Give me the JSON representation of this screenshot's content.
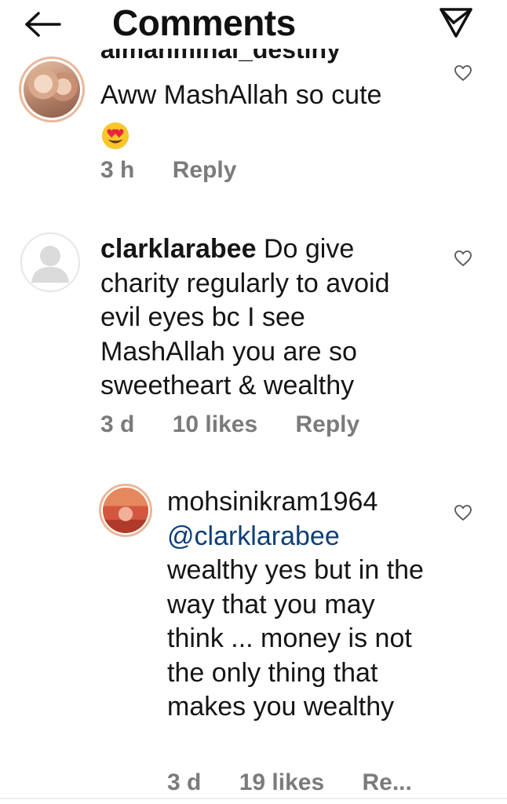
{
  "header": {
    "title": "Comments",
    "back_icon": "arrow-left-icon",
    "share_icon": "paper-plane-icon"
  },
  "comments": [
    {
      "username": "almahmihal_destiny",
      "text": "Aww MashAllah so cute",
      "emoji": "😍",
      "time": "3 h",
      "reply": "Reply"
    },
    {
      "username": "clarklarabee",
      "text": " Do give charity regularly to avoid evil eyes bc I see MashAllah you are so sweetheart & wealthy",
      "time": "3 d",
      "likes": "10 likes",
      "reply": "Reply"
    },
    {
      "username": "mohsinikram1964",
      "mention": "@clarklarabee",
      "text": "wealthy yes but in the way that you may think ... money is not the only thing that makes you wealthy",
      "time": "3 d",
      "likes": "19 likes",
      "reply": "Re..."
    }
  ],
  "colors": {
    "mention": "#0e3f76",
    "meta": "#7b7b7b",
    "story_ring": "#e9b89c"
  }
}
